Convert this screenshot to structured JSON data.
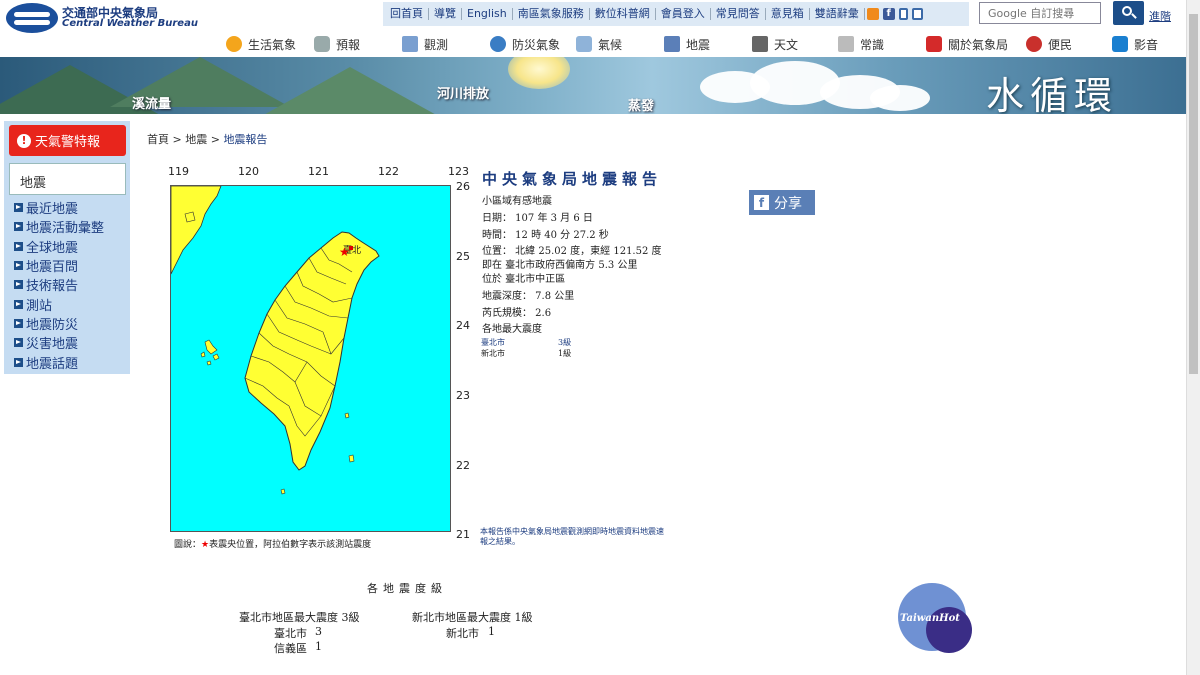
{
  "header": {
    "logo_cn": "交通部中央氣象局",
    "logo_en": "Central Weather Bureau",
    "top_links": [
      "回首頁",
      "導覽",
      "English",
      "南區氣象服務",
      "數位科普網",
      "會員登入",
      "常見問答",
      "意見箱",
      "雙語辭彙"
    ],
    "search_placeholder": "Google 自訂搜尋",
    "advanced_search": "進階"
  },
  "main_nav": [
    "生活氣象",
    "預報",
    "觀測",
    "防災氣象",
    "氣候",
    "地震",
    "天文",
    "常識",
    "關於氣象局",
    "便民",
    "影音"
  ],
  "banner": {
    "labels": [
      "溪流量",
      "河川排放",
      "蒸發"
    ],
    "title": "水循環"
  },
  "sidebar": {
    "warning": "天氣警特報",
    "category": "地震",
    "items": [
      "最近地震",
      "地震活動彙整",
      "全球地震",
      "地震百問",
      "技術報告",
      "測站",
      "地震防災",
      "災害地震",
      "地震話題"
    ]
  },
  "breadcrumb": {
    "home": "首頁",
    "sep": ">",
    "section": "地震",
    "current": "地震報告"
  },
  "map": {
    "lon_ticks": [
      "119",
      "120",
      "121",
      "122",
      "123"
    ],
    "lat_ticks": [
      "26",
      "25",
      "24",
      "23",
      "22",
      "21"
    ],
    "station_label": "臺北",
    "legend": "圖說：",
    "legend_star": "★",
    "legend_text": "表震央位置，阿拉伯數字表示該測站震度"
  },
  "report": {
    "title": "中央氣象局地震報告",
    "subtitle": "小區域有感地震",
    "date": "日期： 107 年 3 月 6 日",
    "time": "時間： 12 時 40 分 27.2 秒",
    "position": "位置： 北緯 25.02 度，東經 121.52 度",
    "relative": "即在 臺北市政府西偏南方 5.3 公里",
    "located": "位於 臺北市中正區",
    "depth": "地震深度： 7.8 公里",
    "magnitude": "芮氏規模： 2.6",
    "max_intensity_title": "各地最大震度",
    "intensities": [
      {
        "city": "臺北市",
        "level": "3級"
      },
      {
        "city": "新北市",
        "level": "1級"
      }
    ],
    "note": "本報告係中央氣象局地震觀測網即時地震資料地震速報之結果。"
  },
  "share_label": "分享",
  "intensity_section": {
    "title": "各地震度級",
    "taipei_max": "臺北市地區最大震度 3級",
    "newtaipei_max": "新北市地區最大震度 1級",
    "taipei_city": "臺北市",
    "taipei_city_level": "3",
    "xinyi": "信義區",
    "xinyi_level": "1",
    "newtaipei_city": "新北市",
    "newtaipei_city_level": "1"
  },
  "watermark": "TaiwanHot",
  "colors": {
    "sea": "#00ffff",
    "land": "#ffff33",
    "accent": "#1d3d80",
    "warning": "#e8251c"
  }
}
